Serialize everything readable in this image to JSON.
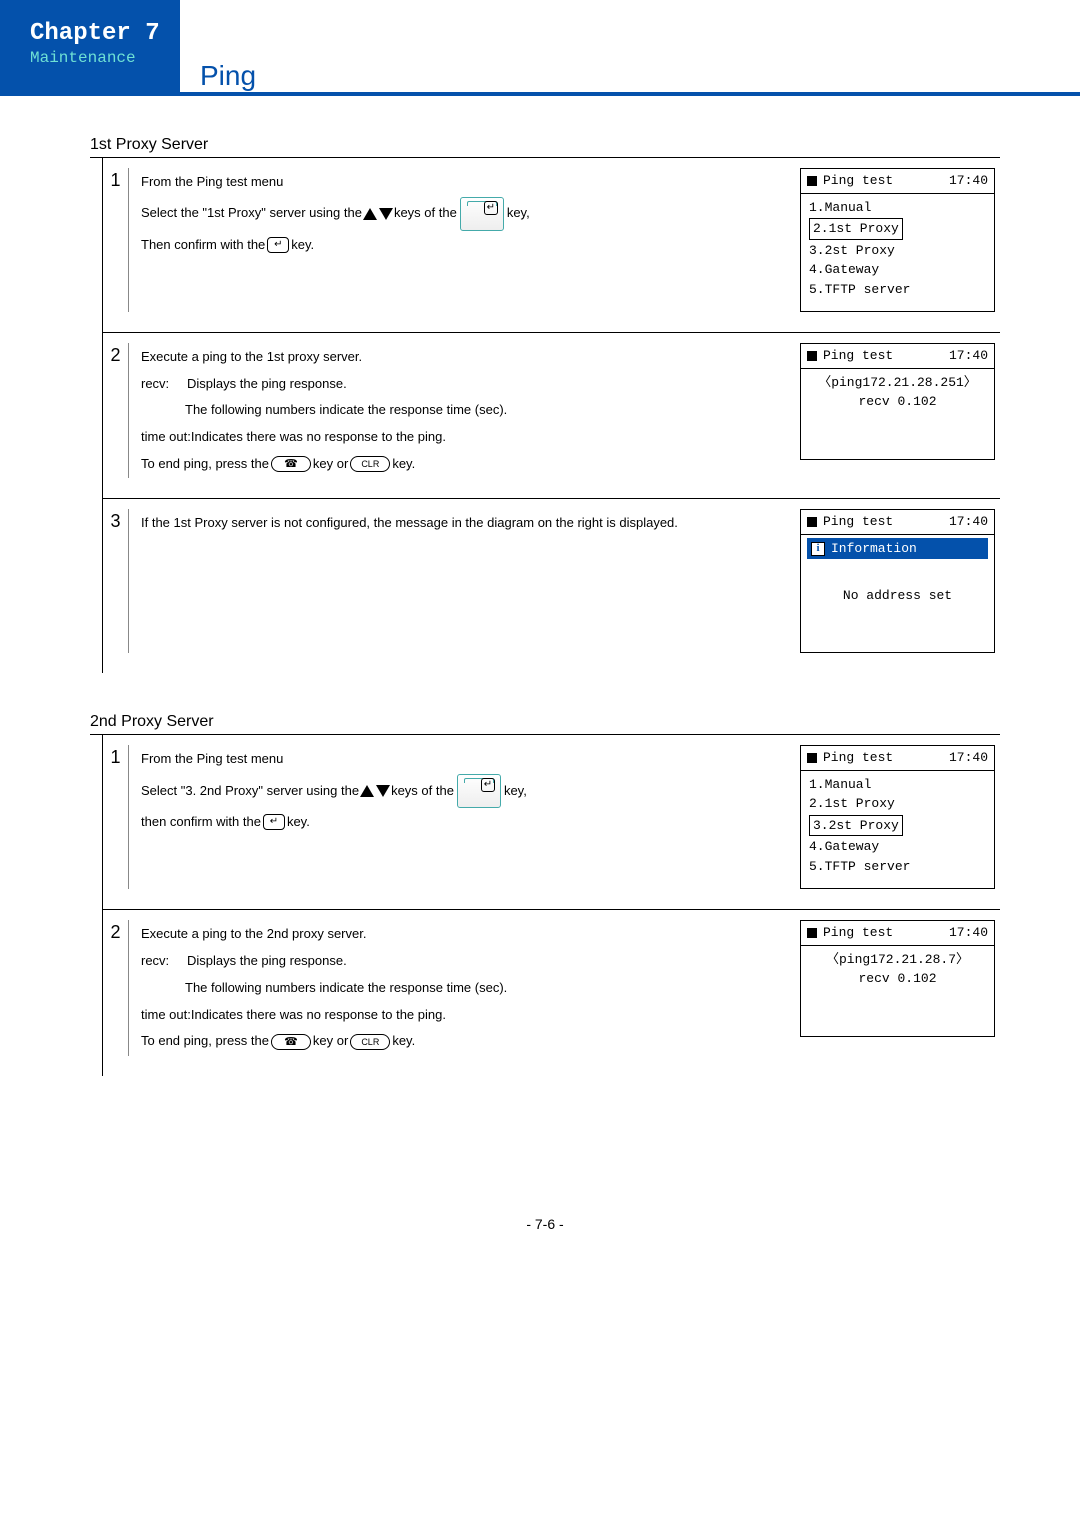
{
  "header": {
    "chapter": "Chapter 7",
    "subtitle": "Maintenance",
    "title": "Ping"
  },
  "page_number": "- 7-6 -",
  "sections": [
    {
      "heading": "1st Proxy Server",
      "steps": [
        {
          "num": "1",
          "lines": {
            "a": "From the Ping test menu",
            "b_pre": "Select the \"1st Proxy\" server using the ",
            "b_mid": " keys of the ",
            "b_post": " key,",
            "c_pre": "Then confirm with the ",
            "c_post": " key."
          },
          "lcd": {
            "title": "Ping test",
            "time": "17:40",
            "items": [
              "1.Manual",
              "2.1st Proxy",
              "3.2st Proxy",
              "4.Gateway",
              "5.TFTP server"
            ],
            "boxed_index": 1
          }
        },
        {
          "num": "2",
          "lines": {
            "a": "Execute a ping to the 1st proxy server.",
            "recv_label": "recv:",
            "recv_text": "Displays the ping response.",
            "recv_sub": "The following numbers indicate the response time (sec).",
            "timeout_label": "time out:",
            "timeout_text": " Indicates there was no response to the ping.",
            "end_pre": "To end ping, press the ",
            "end_mid": " key or ",
            "end_clr": "CLR",
            "end_post": " key."
          },
          "lcd": {
            "title": "Ping test",
            "time": "17:40",
            "ping_line": "〈ping172.21.28.251〉",
            "recv_line": "recv  0.102"
          }
        },
        {
          "num": "3",
          "lines": {
            "a": "If the 1st Proxy server is not configured, the message in the diagram on the right is displayed."
          },
          "lcd": {
            "title": "Ping test",
            "time": "17:40",
            "info": "Information",
            "msg": "No address set"
          }
        }
      ]
    },
    {
      "heading": "2nd Proxy Server",
      "steps": [
        {
          "num": "1",
          "lines": {
            "a": "From the Ping test menu",
            "b_pre": "Select  \"3. 2nd Proxy\" server using the ",
            "b_mid": " keys of the ",
            "b_post": " key,",
            "c_pre": "then confirm with the ",
            "c_post": " key."
          },
          "lcd": {
            "title": "Ping test",
            "time": "17:40",
            "items": [
              "1.Manual",
              "2.1st Proxy",
              "3.2st Proxy",
              "4.Gateway",
              "5.TFTP server"
            ],
            "boxed_index": 2
          }
        },
        {
          "num": "2",
          "lines": {
            "a": "Execute a ping to the 2nd proxy server.",
            "recv_label": "recv:",
            "recv_text": "Displays the ping response.",
            "recv_sub": "The following numbers indicate the response time (sec).",
            "timeout_label": "time out:",
            "timeout_text": " Indicates there was no response to the ping.",
            "end_pre": "To end ping, press the ",
            "end_mid": " key or ",
            "end_clr": "CLR",
            "end_post": " key."
          },
          "lcd": {
            "title": "Ping test",
            "time": "17:40",
            "ping_line": "〈ping172.21.28.7〉",
            "recv_line": "recv  0.102"
          }
        }
      ]
    }
  ]
}
